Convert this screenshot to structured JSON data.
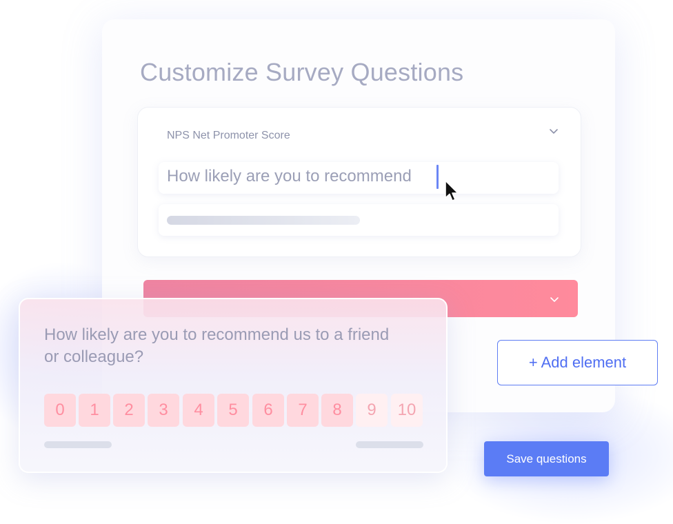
{
  "editor": {
    "title": "Customize Survey Questions",
    "question_block": {
      "type_label": "NPS Net Promoter Score",
      "question_text": "How likely are you to recommend"
    }
  },
  "preview": {
    "question": "How likely are you to recommend us to a friend or colleague?",
    "scale": [
      "0",
      "1",
      "2",
      "3",
      "4",
      "5",
      "6",
      "7",
      "8",
      "9",
      "10"
    ]
  },
  "buttons": {
    "add_element": "+ Add element",
    "save": "Save questions"
  },
  "icons": {
    "panel_toggle": "chevron-down-icon",
    "pink_toggle": "chevron-down-icon",
    "pointer": "mouse-pointer-icon"
  },
  "colors": {
    "accent": "#5b7cf5",
    "pink": "#ff8a9c",
    "title_text": "#a6aac2"
  }
}
